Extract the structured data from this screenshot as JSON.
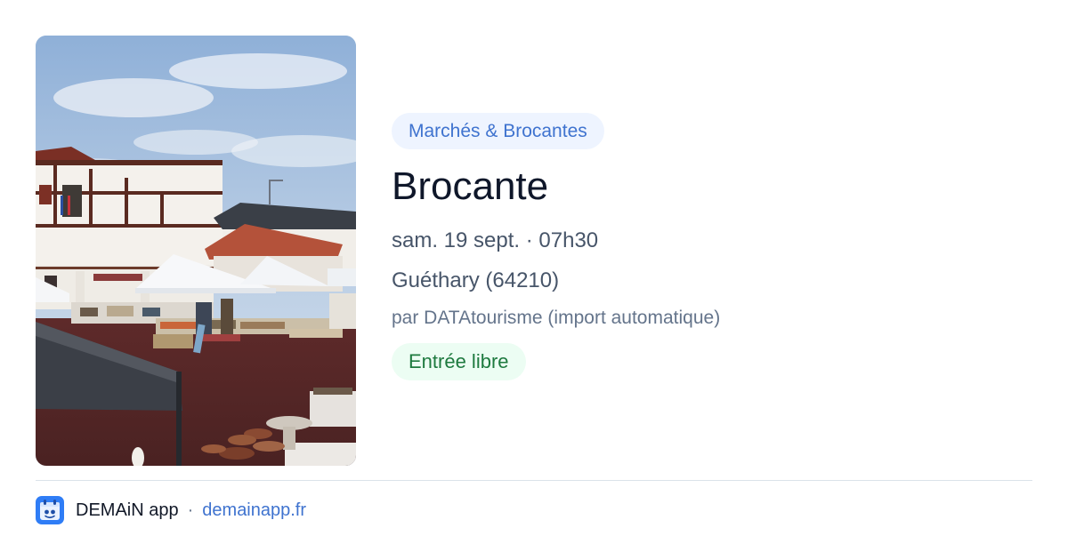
{
  "event": {
    "category": "Marchés & Brocantes",
    "title": "Brocante",
    "date_time": "sam. 19 sept. · 07h30",
    "location": "Guéthary (64210)",
    "source": "par DATAtourisme (import automatique)",
    "price": "Entrée libre"
  },
  "footer": {
    "app_name": "DEMAiN app",
    "separator": "·",
    "link_text": "demainapp.fr",
    "icon": "app-logo-icon"
  },
  "colors": {
    "accent_blue": "#3f73cf",
    "category_bg": "#eef4ff",
    "price_green": "#1e7a3f",
    "price_bg": "#ecfdf3",
    "title": "#0f172a",
    "muted": "#475569",
    "divider": "#dbe3ea"
  }
}
